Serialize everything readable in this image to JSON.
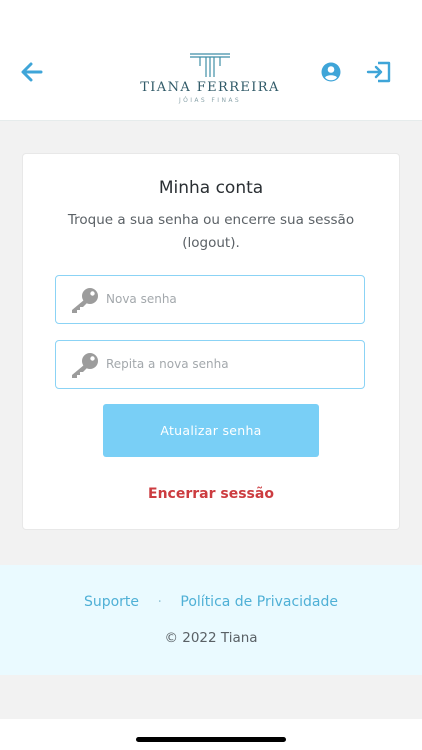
{
  "header": {
    "back_icon": "arrow-left-icon",
    "logo": {
      "name": "TIANA FERREIRA",
      "subtitle": "JÓIAS FINAS"
    },
    "user_icon": "user-circle-icon",
    "logout_icon": "logout-icon",
    "accent_color": "#3fa5d8"
  },
  "account": {
    "title": "Minha conta",
    "description": "Troque a sua senha ou encerre sua sessão (logout).",
    "new_password_placeholder": "Nova senha",
    "repeat_password_placeholder": "Repita a nova senha",
    "field_icon": "key-icon",
    "update_button": "Atualizar senha",
    "logout_link": "Encerrar sessão"
  },
  "footer": {
    "support": "Suporte",
    "separator": "·",
    "privacy": "Política de Privacidade",
    "copyright": "© 2022 Tiana"
  },
  "colors": {
    "button": "#79cff6",
    "field_border": "#8bd3f5",
    "logout_link": "#cc3c40",
    "footer_bg": "#eafaff",
    "footer_link": "#4fb0d6"
  }
}
